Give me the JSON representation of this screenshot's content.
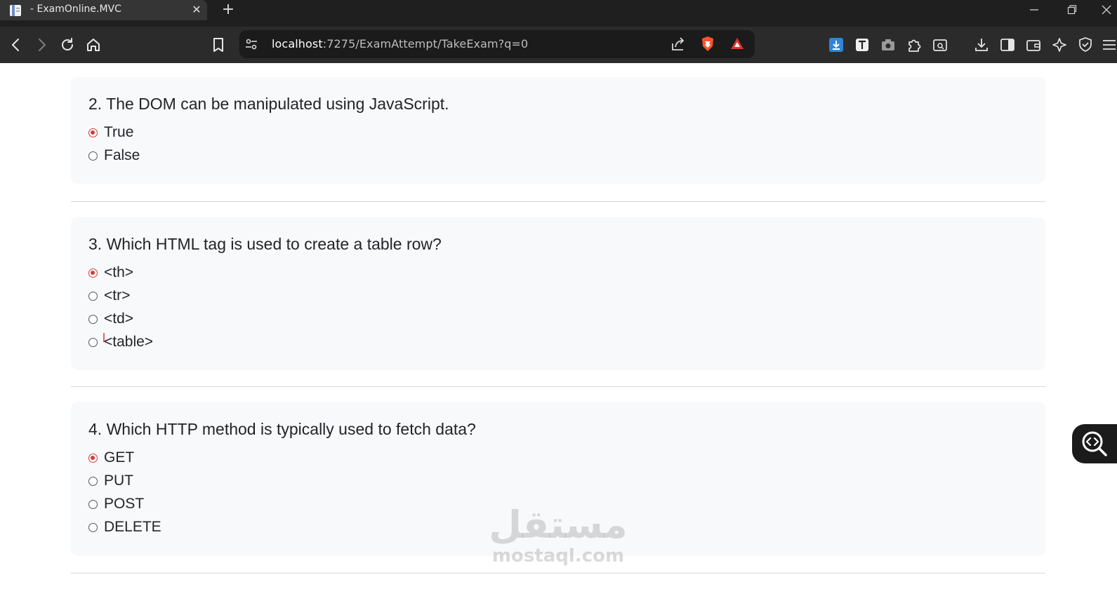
{
  "browser": {
    "tab_title": "- ExamOnline.MVC",
    "tab_close": "✕",
    "new_tab": "+",
    "url_host": "localhost",
    "url_rest": ":7275/ExamAttempt/TakeExam?q=0"
  },
  "questions": [
    {
      "title": "2. The DOM can be manipulated using JavaScript.",
      "options": [
        {
          "label": "True",
          "checked": true
        },
        {
          "label": "False",
          "checked": false
        }
      ]
    },
    {
      "title": "3. Which HTML tag is used to create a table row?",
      "options": [
        {
          "label": "<th>",
          "checked": true
        },
        {
          "label": "<tr>",
          "checked": false
        },
        {
          "label": "<td>",
          "checked": false
        },
        {
          "label": "<table>",
          "checked": false
        }
      ]
    },
    {
      "title": "4. Which HTTP method is typically used to fetch data?",
      "options": [
        {
          "label": "GET",
          "checked": true
        },
        {
          "label": "PUT",
          "checked": false
        },
        {
          "label": "POST",
          "checked": false
        },
        {
          "label": "DELETE",
          "checked": false
        }
      ]
    }
  ],
  "watermark": {
    "arabic": "مستقل",
    "latin": "mostaql.com"
  },
  "colors": {
    "selected_radio": "#d33a3a",
    "card_bg": "#f8f9fa"
  }
}
